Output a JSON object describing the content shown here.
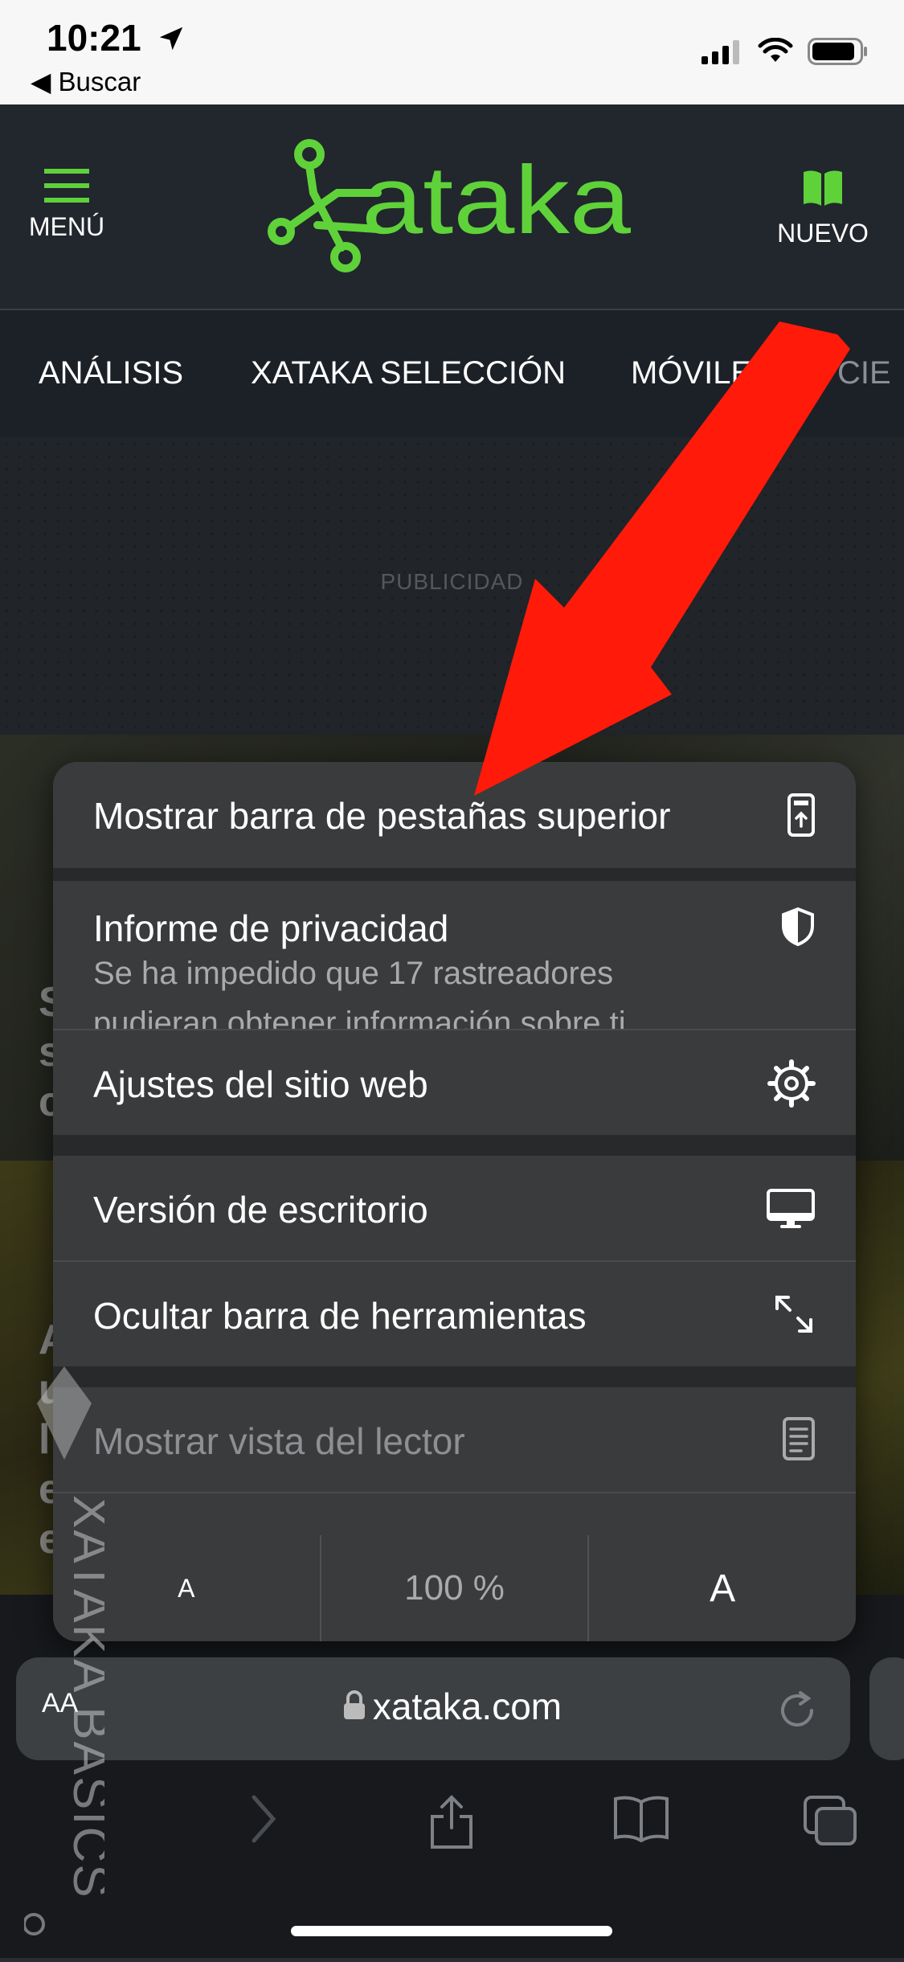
{
  "status_bar": {
    "time": "10:21",
    "back_label": "Buscar"
  },
  "header": {
    "menu_label": "MENÚ",
    "nuevo_label": "NUEVO",
    "logo_text": "xataka",
    "accent_color": "#5fd23a"
  },
  "nav": {
    "items": [
      "ANÁLISIS",
      "XATAKA SELECCIÓN",
      "MÓVILES",
      "CIE"
    ]
  },
  "ad": {
    "label": "PUBLICIDAD"
  },
  "articles": {
    "a1_letters": [
      "S",
      "s",
      "c"
    ],
    "a2_letters": [
      "A",
      "u",
      "l",
      "e",
      "e"
    ]
  },
  "menu": {
    "items": [
      {
        "label": "Mostrar barra de pestañas superior",
        "icon": "tab-bar-top-icon"
      },
      {
        "label": "Informe de privacidad",
        "sub1": "Se ha impedido que 17 rastreadores",
        "sub2": "pudieran obtener información sobre ti",
        "icon": "shield-icon"
      },
      {
        "label": "Ajustes del sitio web",
        "icon": "gear-icon"
      },
      {
        "label": "Versión de escritorio",
        "icon": "desktop-icon"
      },
      {
        "label": "Ocultar barra de herramientas",
        "icon": "expand-arrows-icon"
      },
      {
        "label": "Mostrar vista del lector",
        "icon": "reader-icon"
      }
    ],
    "zoom": {
      "smaller": "A",
      "level": "100 %",
      "larger": "A"
    }
  },
  "url_bar": {
    "aa_label": "AA",
    "url": "xataka.com"
  },
  "watermark": {
    "text": "XATAKA BASICS"
  },
  "annotation": {
    "arrow_color": "#ff0000"
  }
}
